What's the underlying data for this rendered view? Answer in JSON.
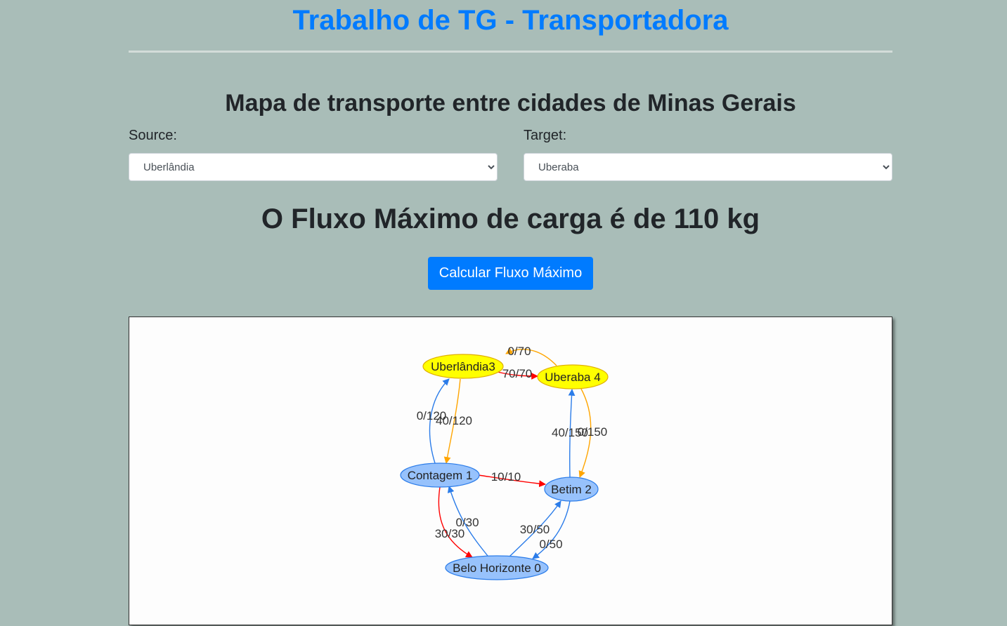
{
  "app_title": "Trabalho de TG - Transportadora",
  "map_heading": "Mapa de transporte entre cidades de Minas Gerais",
  "source": {
    "label": "Source:",
    "selected": "Uberlândia"
  },
  "target": {
    "label": "Target:",
    "selected": "Uberaba"
  },
  "result_text": "O Fluxo Máximo de carga é de 110 kg",
  "calculate_button": "Calcular Fluxo Máximo",
  "graph": {
    "colors": {
      "source_target_fill": "#ffff00",
      "source_target_stroke": "#e0b000",
      "node_fill": "#97c2fc",
      "node_stroke": "#2b7ce9",
      "edge_blue": "#2b7ce9",
      "edge_orange": "#ffa500",
      "edge_red": "#ff0000"
    },
    "nodes": [
      {
        "id": "uberlandia",
        "label": "Uberlândia3",
        "role": "source"
      },
      {
        "id": "uberaba",
        "label": "Uberaba 4",
        "role": "target"
      },
      {
        "id": "contagem",
        "label": "Contagem 1",
        "role": "normal"
      },
      {
        "id": "betim",
        "label": "Betim 2",
        "role": "normal"
      },
      {
        "id": "bh",
        "label": "Belo Horizonte 0",
        "role": "normal"
      }
    ],
    "edges": [
      {
        "from": "uberaba",
        "to": "uberlandia",
        "label": "0/70",
        "color": "orange"
      },
      {
        "from": "uberlandia",
        "to": "uberaba",
        "label": "70/70",
        "color": "red"
      },
      {
        "from": "contagem",
        "to": "uberlandia",
        "label": "0/120",
        "color": "blue"
      },
      {
        "from": "uberlandia",
        "to": "contagem",
        "label": "40/120",
        "color": "orange"
      },
      {
        "from": "betim",
        "to": "uberaba",
        "label": "40/150",
        "color": "blue"
      },
      {
        "from": "uberaba",
        "to": "betim",
        "label": "0/150",
        "color": "orange"
      },
      {
        "from": "contagem",
        "to": "betim",
        "label": "10/10",
        "color": "red"
      },
      {
        "from": "bh",
        "to": "contagem",
        "label": "0/30",
        "color": "blue"
      },
      {
        "from": "contagem",
        "to": "bh",
        "label": "30/30",
        "color": "red"
      },
      {
        "from": "bh",
        "to": "betim",
        "label": "30/50",
        "color": "blue"
      },
      {
        "from": "betim",
        "to": "bh",
        "label": "0/50",
        "color": "blue"
      }
    ]
  }
}
